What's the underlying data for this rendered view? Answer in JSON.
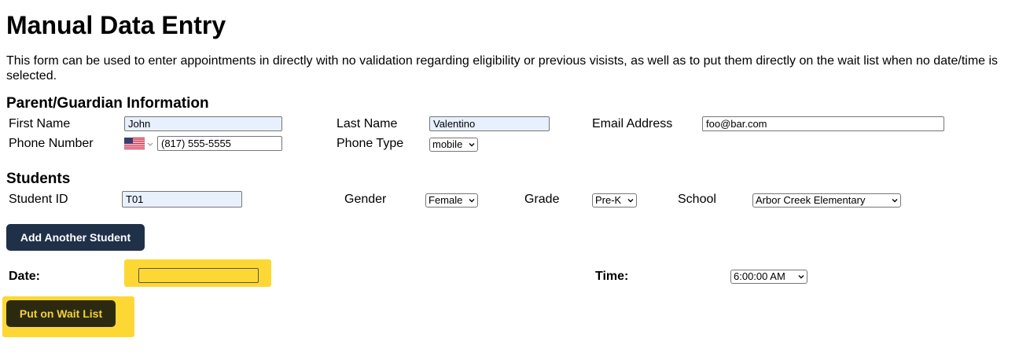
{
  "page": {
    "title": "Manual Data Entry",
    "description": "This form can be used to enter appointments in directly with no validation regarding eligibility or previous visists, as well as to put them directly on the wait list when no date/time is selected."
  },
  "parent": {
    "heading": "Parent/Guardian Information",
    "first_name_label": "First Name",
    "first_name_value": "John",
    "last_name_label": "Last Name",
    "last_name_value": "Valentino",
    "email_label": "Email Address",
    "email_value": "foo@bar.com",
    "phone_label": "Phone Number",
    "phone_value": "(817) 555-5555",
    "phone_country_icon": "us-flag-icon",
    "phone_type_label": "Phone Type",
    "phone_type_value": "mobile"
  },
  "students": {
    "heading": "Students",
    "student_id_label": "Student ID",
    "student_id_value": "T01",
    "gender_label": "Gender",
    "gender_value": "Female",
    "grade_label": "Grade",
    "grade_value": "Pre-K",
    "school_label": "School",
    "school_value": "Arbor Creek Elementary",
    "add_student_button": "Add Another Student"
  },
  "schedule": {
    "date_label": "Date:",
    "date_value": "",
    "time_label": "Time:",
    "time_value": "6:00:00 AM",
    "wait_list_button": "Put on Wait List",
    "highlight_color": "#fdd835"
  },
  "colors": {
    "primary_button": "#1f3049",
    "autofill_background": "#e8f0fe"
  }
}
